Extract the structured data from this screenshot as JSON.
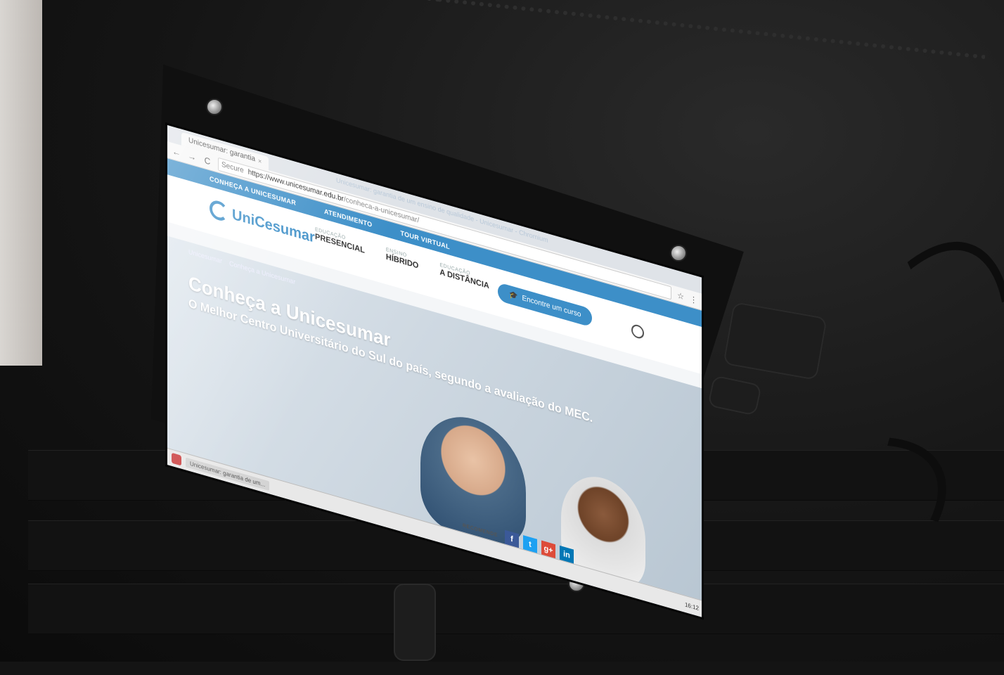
{
  "browser": {
    "tab_title": "Unicesumar: garantia",
    "tab_close": "×",
    "window_title": "Unicesumar: garantia de um ensino de qualidade - Unicesumar - Chromium",
    "secure_label": "Secure",
    "url_host": "https://www.unicesumar.edu.br",
    "url_path": "/conheca-a-unicesumar/",
    "back_icon": "←",
    "forward_icon": "→",
    "reload_icon": "C",
    "star_icon": "☆",
    "menu_icon": "⋮"
  },
  "site": {
    "topnav": [
      "CONHEÇA A UNICESUMAR",
      "ATENDIMENTO",
      "TOUR VIRTUAL"
    ],
    "logo_text": "UniCesumar",
    "menu": [
      {
        "small": "EDUCAÇÃO",
        "big": "PRESENCIAL"
      },
      {
        "small": "ENSINO",
        "big": "HÍBRIDO"
      },
      {
        "small": "EDUCAÇÃO",
        "big": "A DISTÂNCIA"
      }
    ],
    "cta_label": "Encontre um curso",
    "breadcrumb": [
      "Unicesumar",
      "Conheça a Unicesumar"
    ],
    "hero_title": "Conheça a Unicesumar",
    "hero_subtitle": "O Melhor Centro Universitário do Sul do país, segundo a avaliação do MEC.",
    "share_label": "RECOMENDE",
    "social": [
      {
        "label": "f",
        "color": "#3b5998"
      },
      {
        "label": "t",
        "color": "#1da1f2"
      },
      {
        "label": "g+",
        "color": "#dd4b39"
      },
      {
        "label": "in",
        "color": "#0077b5"
      }
    ]
  },
  "taskbar": {
    "task_label": "Unicesumar: garantia de um...",
    "clock": "16:12"
  },
  "colors": {
    "brand": "#3d8fc8"
  }
}
